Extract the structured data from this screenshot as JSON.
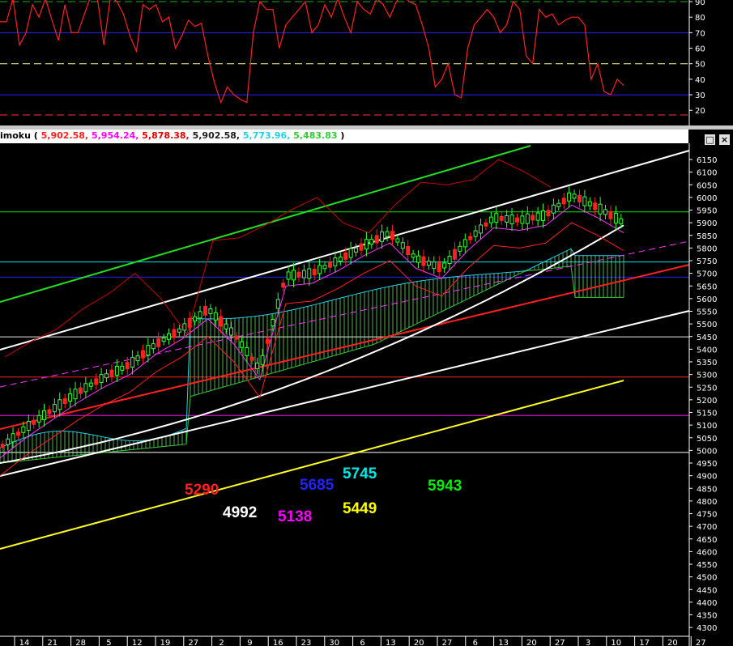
{
  "header": {
    "indicator_name": "imoku",
    "values": [
      {
        "text": "5,902.58,",
        "color": "#ff2020"
      },
      {
        "text": "5,954.24,",
        "color": "#ff00ff"
      },
      {
        "text": "5,878.38,",
        "color": "#e00000"
      },
      {
        "text": "5,902.58,",
        "color": "#202020"
      },
      {
        "text": "5,773.96,",
        "color": "#22cfe8"
      },
      {
        "text": "5,483.83",
        "color": "#33cc33"
      }
    ],
    "close_paren": ")",
    "buttons": [
      "□",
      "×"
    ]
  },
  "rsi_panel": {
    "ticks": [
      90,
      80,
      70,
      60,
      50,
      40,
      30,
      20
    ],
    "levels": [
      {
        "value": 90,
        "color": "#22aa22",
        "style": "dash"
      },
      {
        "value": 70,
        "color": "#2222ff",
        "style": "solid"
      },
      {
        "value": 50,
        "color": "#ffff88",
        "style": "dash"
      },
      {
        "value": 30,
        "color": "#2222ff",
        "style": "solid"
      },
      {
        "value": 17,
        "color": "#ff3333",
        "style": "dash"
      }
    ],
    "series": [
      77,
      77,
      92,
      62,
      70,
      88,
      80,
      92,
      78,
      65,
      88,
      70,
      70,
      82,
      94,
      92,
      62,
      93,
      90,
      82,
      68,
      58,
      88,
      85,
      88,
      77,
      80,
      60,
      68,
      78,
      74,
      76,
      55,
      38,
      25,
      35,
      30,
      27,
      25,
      70,
      90,
      85,
      85,
      60,
      75,
      80,
      85,
      90,
      70,
      75,
      88,
      80,
      92,
      80,
      70,
      90,
      85,
      82,
      92,
      88,
      80,
      90,
      94,
      90,
      88,
      75,
      60,
      35,
      40,
      50,
      30,
      28,
      60,
      75,
      80,
      85,
      80,
      70,
      75,
      90,
      85,
      55,
      50,
      85,
      80,
      82,
      75,
      78,
      80,
      80,
      75,
      40,
      50,
      32,
      30,
      40,
      36
    ]
  },
  "price_panel": {
    "ticks": [
      6150,
      6100,
      6050,
      6000,
      5950,
      5900,
      5850,
      5800,
      5750,
      5700,
      5650,
      5600,
      5550,
      5500,
      5450,
      5400,
      5350,
      5300,
      5250,
      5200,
      5150,
      5100,
      5050,
      5000,
      4950,
      4900,
      4850,
      4800,
      4750,
      4700,
      4650,
      4600,
      4550,
      4500,
      4450,
      4400,
      4350,
      4300
    ],
    "horizontal_levels": [
      {
        "value": 5943,
        "color": "#00ee00"
      },
      {
        "value": 5745,
        "color": "#00e5e5"
      },
      {
        "value": 5685,
        "color": "#2222ff"
      },
      {
        "value": 5449,
        "color": "#e8e8e8"
      },
      {
        "value": 5290,
        "color": "#ff2020"
      },
      {
        "value": 5138,
        "color": "#ff00ff"
      },
      {
        "value": 4992,
        "color": "#ffffff"
      }
    ],
    "labels": [
      {
        "text": "5290",
        "color": "#ff2020"
      },
      {
        "text": "4992",
        "color": "#ffffff"
      },
      {
        "text": "5138",
        "color": "#ff00ff"
      },
      {
        "text": "5685",
        "color": "#2222ff"
      },
      {
        "text": "5745",
        "color": "#00e5e5"
      },
      {
        "text": "5449",
        "color": "#ffff00"
      },
      {
        "text": "5943",
        "color": "#00ee00"
      }
    ]
  },
  "chart_data": {
    "type": "line",
    "x": [
      "14",
      "21",
      "28",
      "5",
      "12",
      "19",
      "27",
      "2",
      "9",
      "16",
      "23",
      "30",
      "6",
      "13",
      "20",
      "27",
      "6",
      "13",
      "20",
      "27",
      "3",
      "10",
      "17",
      "20",
      "27"
    ],
    "series": [
      {
        "values": [
          5010,
          5090,
          5160,
          5230,
          5290,
          5340,
          5420,
          5480,
          5560,
          5460,
          5320,
          5690,
          5700,
          5750,
          5810,
          5860,
          5760,
          5720,
          5830,
          5920,
          5910,
          5930,
          6010,
          5960,
          5900
        ]
      }
    ],
    "ylim": [
      4300,
      6180
    ]
  }
}
